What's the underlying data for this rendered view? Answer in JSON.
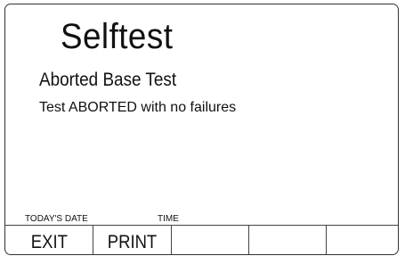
{
  "screen": {
    "title": "Selftest",
    "subtitle": "Aborted Base Test",
    "message": "Test ABORTED with no failures"
  },
  "footer": {
    "date_label": "TODAY'S DATE",
    "time_label": "TIME"
  },
  "softkeys": [
    {
      "label": "EXIT"
    },
    {
      "label": "PRINT"
    },
    {
      "label": ""
    },
    {
      "label": ""
    },
    {
      "label": ""
    }
  ]
}
